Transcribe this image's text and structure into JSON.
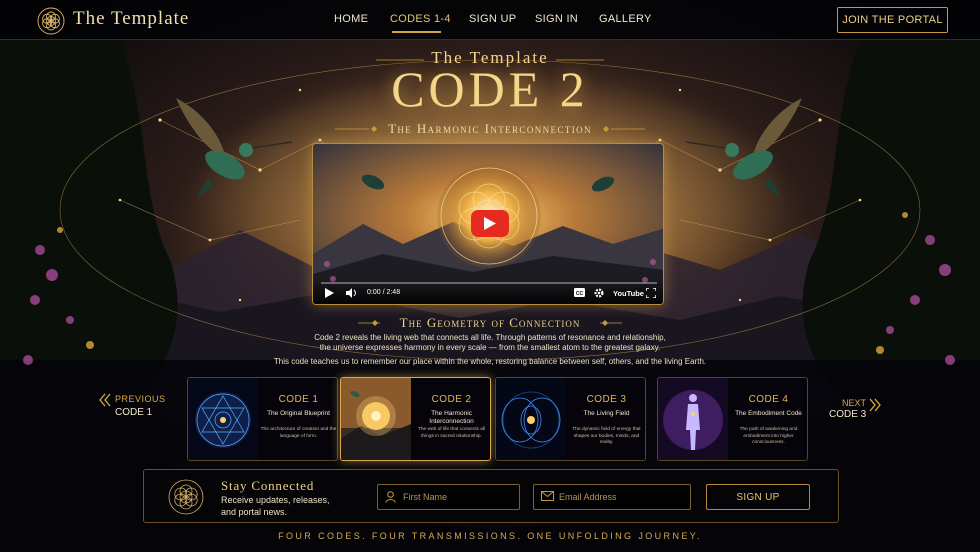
{
  "brand": {
    "name": "The Template",
    "logo_icon": "flower-of-life-icon"
  },
  "nav": {
    "items": [
      {
        "label": "HOME",
        "active": false
      },
      {
        "label": "CODES 1-4",
        "active": true
      },
      {
        "label": "SIGN UP",
        "active": false
      },
      {
        "label": "SIGN IN",
        "active": false
      },
      {
        "label": "GALLERY",
        "active": false
      }
    ],
    "cta": "JOIN THE PORTAL"
  },
  "hero": {
    "eyebrow": "The Template",
    "title": "CODE 2",
    "subtitle": "The Harmonic Interconnection"
  },
  "video": {
    "time": "0:00 / 2:48",
    "progress": 0,
    "brand": "YouTube",
    "controls": [
      "play-icon",
      "volume-icon",
      "captions-icon",
      "settings-icon",
      "youtube-logo",
      "fullscreen-icon"
    ]
  },
  "section": {
    "heading": "The Geometry of Connection",
    "paragraph_lines": [
      "Code 2 reveals the living web that connects all life. Through patterns of resonance and relationship,",
      "the universe expresses harmony in every scale — from the smallest atom to the greatest galaxy."
    ],
    "paragraph2": "This code teaches us to remember our place within the whole, restoring balance between self, others, and the living Earth."
  },
  "pager": {
    "prev_label": "PREVIOUS",
    "prev_code": "CODE 1",
    "next_label": "NEXT",
    "next_code": "CODE 3"
  },
  "cards": [
    {
      "code": "CODE 1",
      "name": "The Original Blueprint",
      "desc": "The architecture of creation and the language of form.",
      "active": false
    },
    {
      "code": "CODE 2",
      "name": "The Harmonic Interconnection",
      "desc": "The web of life that connects all things in sacred relationship.",
      "active": true
    },
    {
      "code": "CODE 3",
      "name": "The Living Field",
      "desc": "The dynamic field of energy that shapes our bodies, minds, and reality.",
      "active": false
    },
    {
      "code": "CODE 4",
      "name": "The Embodiment Code",
      "desc": "The path of awakening and embodiment into higher consciousness.",
      "active": false
    }
  ],
  "newsletter": {
    "title": "Stay Connected",
    "desc_lines": [
      "Receive updates, releases,",
      "and portal news."
    ],
    "first_name_placeholder": "First Name",
    "email_placeholder": "Email Address",
    "first_name_value": "",
    "email_value": "",
    "button": "SIGN UP"
  },
  "tagline": "FOUR CODES. FOUR TRANSMISSIONS. ONE UNFOLDING JOURNEY.",
  "colors": {
    "gold": "#d4a53f",
    "background": "#05040a",
    "youtube_red": "#e52a21"
  }
}
